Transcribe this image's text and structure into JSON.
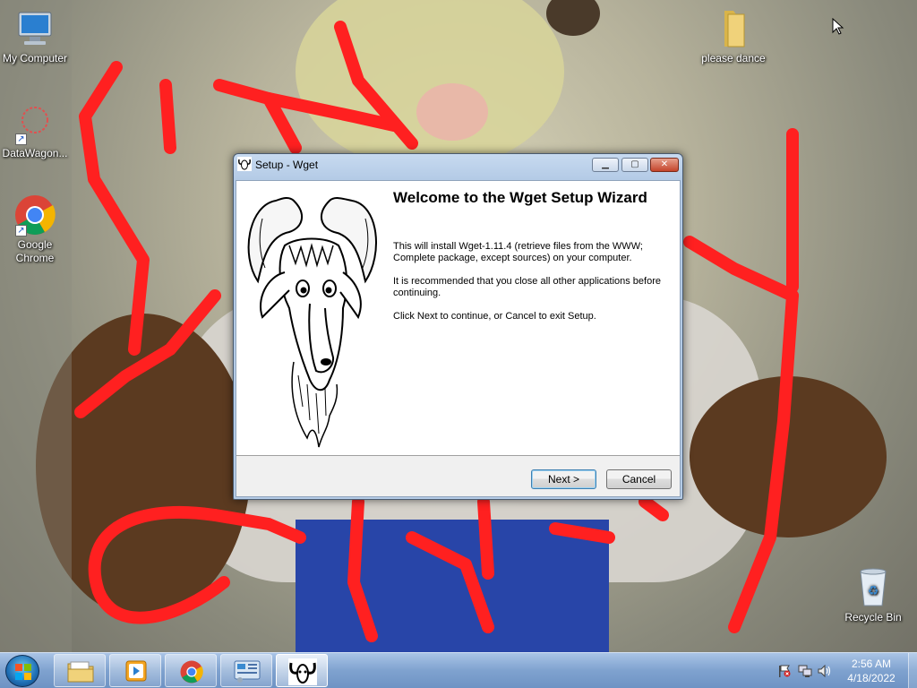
{
  "desktop": {
    "icons": [
      {
        "label": "My Computer",
        "icon": "computer-icon"
      },
      {
        "label": "DataWagon...",
        "icon": "shortcut-icon"
      },
      {
        "label": "Google Chrome",
        "icon": "chrome-icon"
      },
      {
        "label": "please dance",
        "icon": "folder-icon"
      },
      {
        "label": "Recycle Bin",
        "icon": "recycle-bin-icon"
      }
    ]
  },
  "dialog": {
    "title": "Setup - Wget",
    "icon": "gnu-icon",
    "welcome_title": "Welcome to the Wget Setup Wizard",
    "text1": "This will install Wget-1.11.4 (retrieve files from the WWW; Complete package, except sources) on your computer.",
    "text2": "It is recommended that you close all other applications before continuing.",
    "text3": "Click Next to continue, or Cancel to exit Setup.",
    "next_label": "Next >",
    "cancel_label": "Cancel"
  },
  "taskbar": {
    "items": [
      "start-orb",
      "file-explorer",
      "media-player",
      "google-chrome",
      "control-panel",
      "wget-setup"
    ],
    "active_item": "wget-setup",
    "clock_time": "2:56 AM",
    "clock_date": "4/18/2022"
  },
  "colors": {
    "taskbar": "#7fa2cf",
    "scribble": "#ff2020",
    "dialog_frame": "#b4cbe6"
  }
}
